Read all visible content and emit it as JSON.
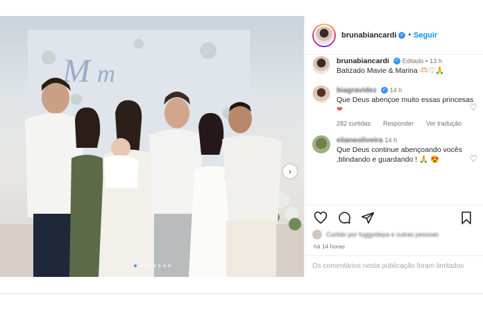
{
  "post": {
    "author": "brunabiancardi",
    "separator": "•",
    "follow_label": "Seguir",
    "carousel": {
      "slide_count": 8,
      "active_slide": 1
    }
  },
  "caption": {
    "author": "brunabiancardi",
    "edited": "Editado",
    "time": "13 h",
    "text": "Batizado Mavie & Marina"
  },
  "comments": [
    {
      "author": "biagravidez",
      "time": "14 h",
      "text": "Que Deus abençoe muito essas princesas",
      "likes": "282 curtidas",
      "reply_label": "Responder",
      "translate_label": "Ver tradução"
    },
    {
      "author": "elianeoliveira",
      "time": "14 h",
      "text": "Que Deus continue abençoando vocês ,blindando e guardando !"
    }
  ],
  "likes_line": "Curtido por fuggyidepa e outras pessoas",
  "time_ago": "há 14 horas",
  "comments_closed": "Os comentários nesta publicação foram limitados",
  "colors": {
    "accent": "#0095f6",
    "verified": "#3897f0",
    "like_red": "#ed4956"
  }
}
